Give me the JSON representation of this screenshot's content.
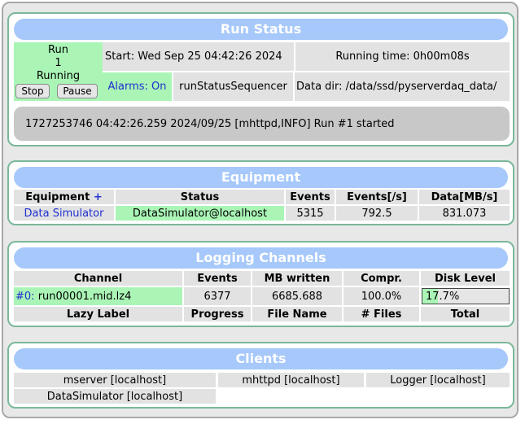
{
  "run_status": {
    "title": "Run Status",
    "state_label": "Run",
    "run_number": "1",
    "state": "Running",
    "stop_label": "Stop",
    "pause_label": "Pause",
    "start_time": "Start: Wed Sep 25 04:42:26 2024",
    "running_time": "Running time: 0h00m08s",
    "alarms": "Alarms: On",
    "sequencer": "runStatusSequencer",
    "data_dir": "Data dir: /data/ssd/pyserverdaq_data/",
    "message": "1727253746 04:42:26.259 2024/09/25 [mhttpd,INFO] Run #1 started"
  },
  "equipment": {
    "title": "Equipment",
    "headers": {
      "equipment": "Equipment",
      "add": "+",
      "status": "Status",
      "events": "Events",
      "rate": "Events[/s]",
      "data": "Data[MB/s]"
    },
    "rows": [
      {
        "name": "Data Simulator",
        "status": "DataSimulator@localhost",
        "events": "5315",
        "rate": "792.5",
        "data": "831.073"
      }
    ]
  },
  "logging": {
    "title": "Logging Channels",
    "headers": [
      "Channel",
      "Events",
      "MB written",
      "Compr.",
      "Disk Level"
    ],
    "rows": [
      {
        "channel_link": "#0:",
        "channel_file": "run00001.mid.lz4",
        "events": "6377",
        "mb_written": "6685.688",
        "compression": "100.0%",
        "disk_level": "17.7%",
        "disk_fraction": 0.177
      }
    ],
    "lazy_headers": [
      "Lazy Label",
      "Progress",
      "File Name",
      "# Files",
      "Total"
    ]
  },
  "clients": {
    "title": "Clients",
    "items": [
      "mserver [localhost]",
      "mhttpd [localhost]",
      "Logger [localhost]",
      "DataSimulator [localhost]"
    ]
  },
  "colors": {
    "header_bar": "#a6c8fa",
    "panel_border": "#7ab89a",
    "running_green": "#aaf5b6",
    "link_blue": "#1f2fd0"
  }
}
